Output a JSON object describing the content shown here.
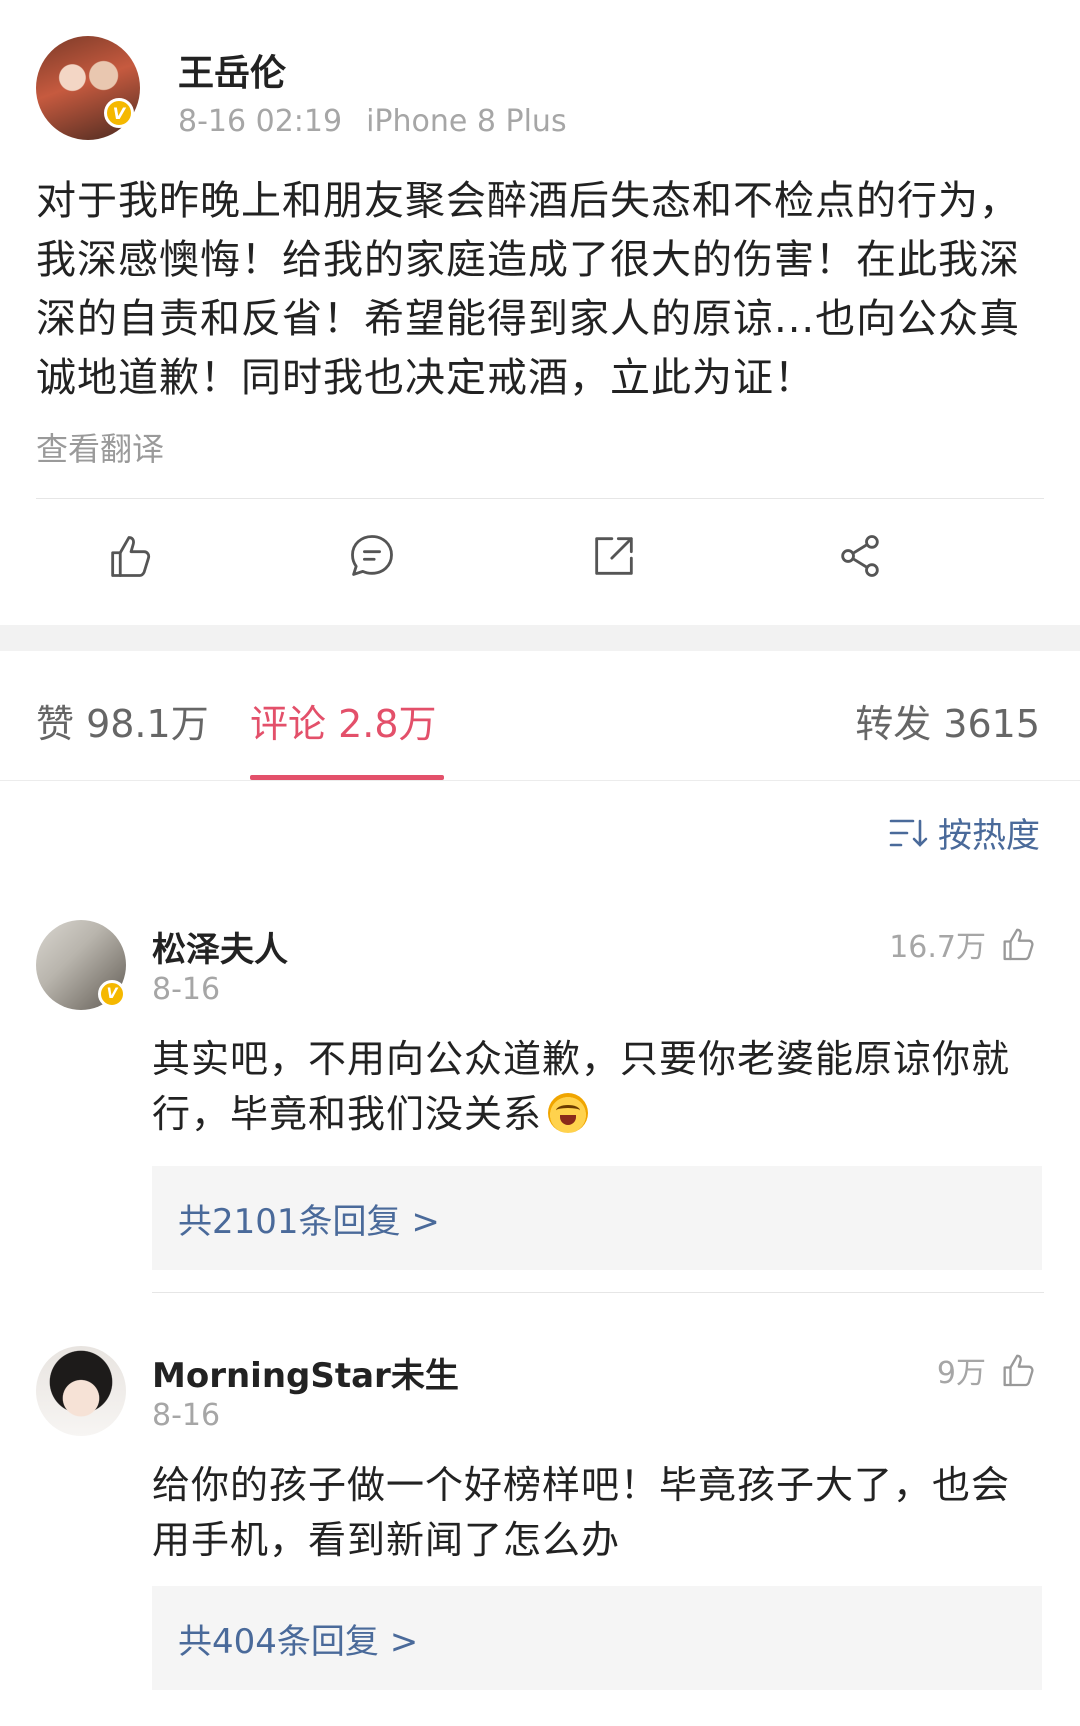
{
  "post": {
    "author": "王岳伦",
    "time": "8-16 02:19",
    "device": "iPhone 8 Plus",
    "text": "对于我昨晚上和朋友聚会醉酒后失态和不检点的行为，我深感懊悔！给我的家庭造成了很大的伤害！在此我深深的自责和反省！希望能得到家人的原谅...也向公众真诚地道歉！同时我也决定戒酒，立此为证！",
    "translate_label": "查看翻译",
    "verified_mark": "V"
  },
  "actions": {
    "like_icon": "thumbs-up-icon",
    "comment_icon": "comment-icon",
    "repost_icon": "repost-icon",
    "share_icon": "share-icon"
  },
  "tabs": {
    "likes": "赞 98.1万",
    "comments": "评论 2.8万",
    "reposts": "转发 3615"
  },
  "sort_label": "按热度",
  "comments": [
    {
      "name": "松泽夫人",
      "date": "8-16",
      "likes": "16.7万",
      "text": "其实吧，不用向公众道歉，只要你老婆能原谅你就行，毕竟和我们没关系",
      "replies": "共2101条回复 >",
      "verified_mark": "V"
    },
    {
      "name": "MorningStar未生",
      "date": "8-16",
      "likes": "9万",
      "text": "给你的孩子做一个好榜样吧！毕竟孩子大了，也会用手机，看到新闻了怎么办",
      "replies": "共404条回复 >"
    }
  ],
  "colors": {
    "accent": "#e3506a",
    "link": "#4a6a9a",
    "muted": "#a6a6a6",
    "verified": "#f5b800"
  }
}
